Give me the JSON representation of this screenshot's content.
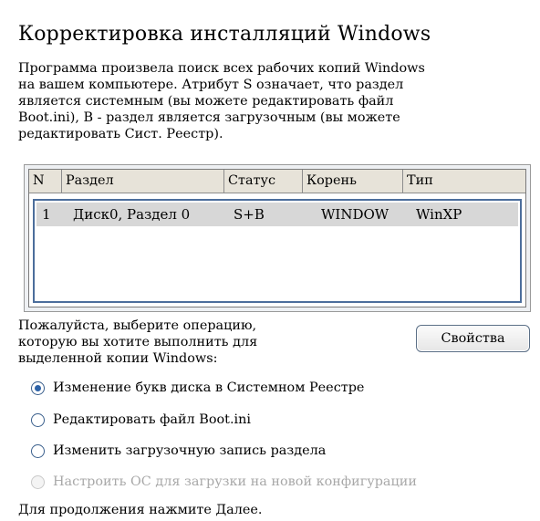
{
  "header": {
    "title": "Корректировка инсталляций Windows"
  },
  "intro": {
    "line1": "Программа произвела поиск всех рабочих копий Windows",
    "line2": "на вашем компьютере. Атрибут S означает, что раздел",
    "line3": "является системным (вы можете редактировать файл",
    "line4": "Boot.ini), B - раздел является загрузочным (вы можете",
    "line5": "редактировать Сист. Реестр)."
  },
  "table": {
    "columns": [
      "N",
      "Раздел",
      "Статус",
      "Корень",
      "Тип"
    ],
    "rows": [
      {
        "n": "1",
        "partition": "Диск0, Раздел 0",
        "status": "S+B",
        "root": "WINDOW",
        "type": "WinXP"
      }
    ]
  },
  "operation": {
    "line1": "Пожалуйста, выберите операцию,",
    "line2": "которую вы хотите выполнить для",
    "line3": "выделенной копии Windows:",
    "properties_button": "Свойства"
  },
  "options": [
    {
      "label": "Изменение букв диска в Системном Реестре",
      "checked": true,
      "disabled": false
    },
    {
      "label": "Редактировать файл Boot.ini",
      "checked": false,
      "disabled": false
    },
    {
      "label": "Изменить загрузочную запись раздела",
      "checked": false,
      "disabled": false
    },
    {
      "label": "Настроить ОС для загрузки на новой конфигурации",
      "checked": false,
      "disabled": true
    }
  ],
  "footer": {
    "text": "Для продолжения нажмите Далее."
  }
}
